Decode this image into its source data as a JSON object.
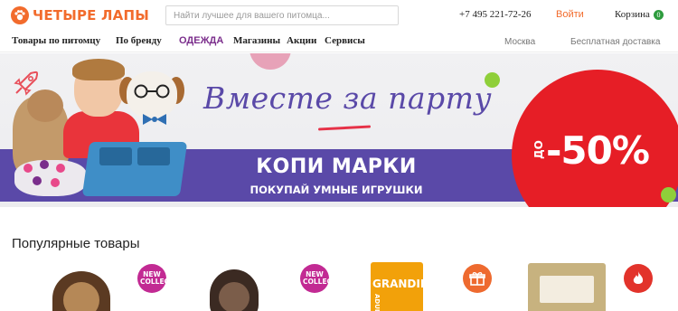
{
  "header": {
    "logo_text": "ЧЕТЫРЕ ЛАПЫ",
    "logo_icon": "paw-icon",
    "search_placeholder": "Найти лучшее для вашего питомца...",
    "phone": "+7 495 221-72-26",
    "login_label": "Войти",
    "cart_label": "Корзина",
    "cart_count": "0"
  },
  "nav": {
    "items": [
      {
        "label": "Товары по питомцу"
      },
      {
        "label": "По бренду"
      },
      {
        "label": "ОДЕЖДА"
      },
      {
        "label": "Магазины"
      },
      {
        "label": "Акции"
      },
      {
        "label": "Сервисы"
      }
    ],
    "city": "Москва",
    "delivery": "Бесплатная доставка"
  },
  "banner": {
    "title": "Вместе за парту",
    "line1": "КОПИ МАРКИ",
    "line2": "ПОКУПАЙ УМНЫЕ ИГРУШКИ",
    "sale_prefix": "ДО",
    "sale_value": "-50%",
    "colors": {
      "band": "#5a49a8",
      "sale": "#e61e26",
      "accent_dot": "#8fcf3a",
      "pink": "#e7a2b8"
    }
  },
  "popular": {
    "title": "Популярные товары",
    "products": [
      {
        "badge_type": "new",
        "badge_text": "NEW COLLECTION",
        "image": "yorkie-dog-image"
      },
      {
        "badge_type": "new",
        "badge_text": "NEW COLLECTION",
        "image": "sphynx-cat-image"
      },
      {
        "badge_type": "gift",
        "badge_text": "",
        "image": "grandin-food-pack",
        "pack_brand": "GRANDIN",
        "pack_sub": "ADULT"
      },
      {
        "badge_type": "hot",
        "badge_text": "",
        "image": "kraft-food-pack"
      }
    ]
  },
  "colors": {
    "brand_orange": "#f26b2c",
    "nav_accent": "#7b2e8c",
    "cart_badge": "#2e9c3e"
  }
}
